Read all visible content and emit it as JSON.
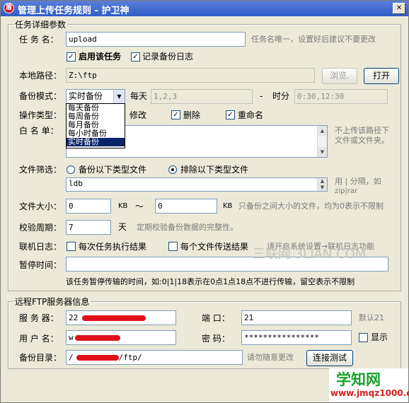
{
  "window": {
    "title": "管理上传任务规则 - 护卫神",
    "app_icon": "shield-icon"
  },
  "task_group": {
    "legend": "任务详细参数",
    "task_name": {
      "label": "任 务 名：",
      "value": "upload",
      "hint": "任务名唯一，设置好后建议不要更改"
    },
    "enable_task": {
      "label": "启用该任务",
      "checked": true
    },
    "log_backup": {
      "label": "记录备份日志",
      "checked": true
    },
    "local_path": {
      "label": "本地路径：",
      "value": "Z:\\ftp",
      "browse_label": "浏览.",
      "open_label": "打开"
    },
    "backup_mode": {
      "label": "备份模式：",
      "selected": "实时备份",
      "options": [
        "每天备份",
        "每周备份",
        "每月备份",
        "每小时备份",
        "实时备份"
      ],
      "daily_label": "每天",
      "days_value": "1,2,3",
      "dash": "-",
      "time_label": "时分",
      "time_value": "0:30,12:30"
    },
    "operation_type": {
      "label": "操作类型：",
      "modify_label": "修改",
      "delete_label": "删除",
      "delete_checked": true,
      "rename_label": "重命名",
      "rename_checked": true
    },
    "whitelist": {
      "label": "白 名 单：",
      "hint_line1": "不上传该路径下",
      "hint_line2": "文件或文件夹。"
    },
    "file_filter": {
      "label": "文件筛选：",
      "include_label": "备份以下类型文件",
      "include_selected": false,
      "exclude_label": "排除以下类型文件",
      "exclude_selected": true,
      "value": "ldb",
      "hint_line1": "用 | 分隔，如",
      "hint_line2": "zip|rar"
    },
    "file_size": {
      "label": "文件大小：",
      "min_value": "0",
      "min_unit": "KB",
      "tilde": "～",
      "max_value": "0",
      "max_unit": "KB",
      "hint": "只备份之间大小的文件，均为0表示不限制"
    },
    "verify_period": {
      "label": "校验周期：",
      "value": "7",
      "unit": "天",
      "hint": "定期校验备份数据的完整性。"
    },
    "online_log": {
      "label": "联机日志：",
      "each_task_label": "每次任务执行结果",
      "each_task_checked": false,
      "each_file_label": "每个文件传送结果",
      "each_file_checked": false,
      "hint": "请开启系统设置→联机日志功能"
    },
    "pause_time": {
      "label": "暂停时间：",
      "value": "",
      "description": "该任务暂停传输的时间，如:0|1|18表示在0点1点18点不进行传输，留空表示不限制"
    }
  },
  "ftp_group": {
    "legend": "远程FTP服务器信息",
    "server": {
      "label": "服 务 器：",
      "value": "22"
    },
    "port": {
      "label": "端   口：",
      "value": "21",
      "hint": "默认21"
    },
    "username": {
      "label": "用 户 名：",
      "value": "w"
    },
    "password": {
      "label": "密   码：",
      "value": "****************",
      "show_label": "显示",
      "show_checked": false
    },
    "backup_dir": {
      "label": "备份目录：",
      "value_prefix": "/",
      "value_suffix": "/ftp/",
      "hint": "请勿随意更改",
      "test_label": "连接测试"
    }
  },
  "watermarks": {
    "center": "三联网 3LIAN.COM",
    "brand_line1": "学知网",
    "brand_line2": "www.jmqz1000.com"
  },
  "colors": {
    "title_bar": "#2f5cc8",
    "selection": "#0a246a",
    "redaction": "#e0101a",
    "brand_green": "#1aa12a",
    "brand_red": "#d81e1e"
  }
}
